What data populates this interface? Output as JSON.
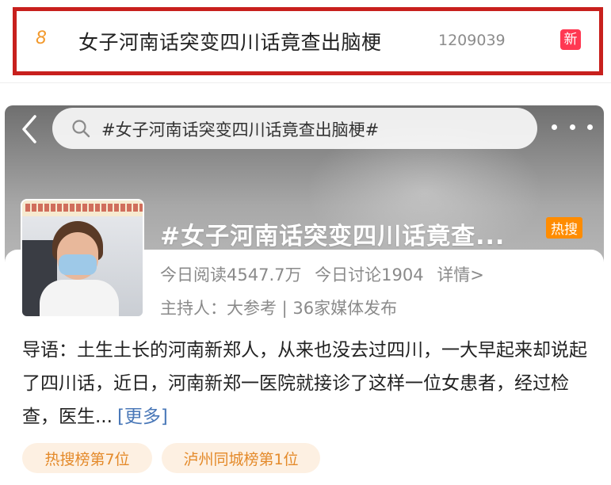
{
  "hot_item": {
    "rank": "8",
    "title": "女子河南话突变四川话竟查出脑梗",
    "count": "1209039",
    "new_badge": "新"
  },
  "topic_page": {
    "search_text": "#女子河南话突变四川话竟查出脑梗#",
    "title": "#女子河南话突变四川话竟查...",
    "hot_badge": "热搜",
    "stats": {
      "read": "今日阅读4547.7万",
      "discuss": "今日讨论1904",
      "details": "详情>"
    },
    "host": "主持人：大参考 | 36家媒体发布",
    "intro": "导语：土生土长的河南新郑人，从来也没去过四川，一大早起来却说起了四川话，近日，河南新郑一医院就接诊了这样一位女患者，经过检查，医生...",
    "intro_more": "[更多]",
    "tags": [
      "热搜榜第7位",
      "泸州同城榜第1位"
    ]
  },
  "colors": {
    "highlight_border": "#c8201d",
    "rank": "#f29a2e",
    "new_badge": "#ff3852",
    "hot_badge": "#ff8c00",
    "link": "#4a78b8",
    "tag_text": "#e48a2a",
    "tag_bg": "#fdf0e2"
  }
}
